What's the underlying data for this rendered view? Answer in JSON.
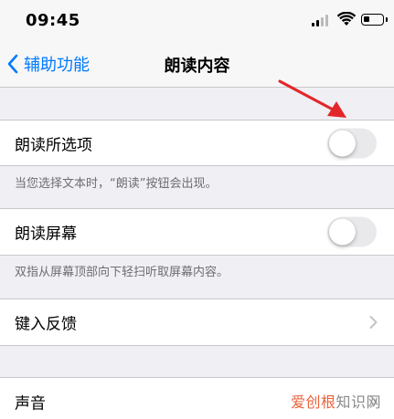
{
  "status_bar": {
    "time": "09:45",
    "icons": [
      "signal-icon",
      "wifi-icon",
      "battery-icon"
    ]
  },
  "nav": {
    "back_label": "辅助功能",
    "title": "朗读内容"
  },
  "settings": {
    "speak_selection": {
      "label": "朗读所选项",
      "enabled": false,
      "footer": "当您选择文本时，“朗读”按钮会出现。"
    },
    "speak_screen": {
      "label": "朗读屏幕",
      "enabled": false,
      "footer": "双指从屏幕顶部向下轻扫听取屏幕内容。"
    },
    "typing_feedback": {
      "label": "键入反馈"
    },
    "voices": {
      "label": "声音"
    }
  },
  "watermark": {
    "accent": "爱创根",
    "rest": "知识网"
  },
  "colors": {
    "accent_blue": "#007aff",
    "toggle_off": "#e9e9eb",
    "annotation_arrow": "#e3262a",
    "background": "#efeff4"
  }
}
